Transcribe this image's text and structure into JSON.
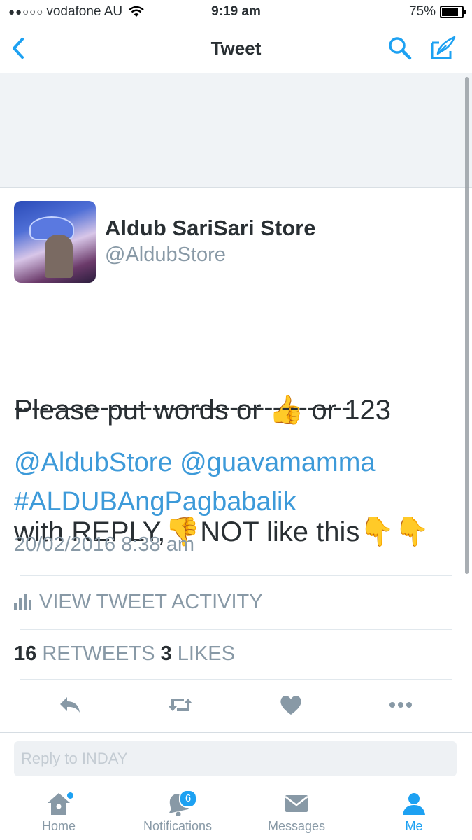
{
  "status_bar": {
    "signal_dots": "●●○○○",
    "carrier": "vodafone AU",
    "time": "9:19 am",
    "battery_label": "75%",
    "battery_level": 0.75
  },
  "nav": {
    "title": "Tweet",
    "back_icon": "chevron-left-icon",
    "search_icon": "search-icon",
    "compose_icon": "compose-icon"
  },
  "tweet": {
    "display_name": "Aldub SariSari Store",
    "handle": "@AldubStore",
    "text_line1": "Please put words or 👍 or 123",
    "text_line2": "with REPLY,👎NOT like this👇👇",
    "divider": "---------------------------------------",
    "mention1": "@AldubStore",
    "mention2": "@guavamamma",
    "hashtag": "#ALDUBAngPagbabalik",
    "timestamp": "20/02/2016 8:38 am"
  },
  "activity": {
    "label": "VIEW TWEET ACTIVITY"
  },
  "stats": {
    "retweets_count": "16",
    "retweets_label": "RETWEETS",
    "likes_count": "3",
    "likes_label": "LIKES"
  },
  "actions": [
    "reply-icon",
    "retweet-icon",
    "heart-icon",
    "more-icon"
  ],
  "reply": {
    "placeholder": "Reply to INDAY"
  },
  "tabbar": {
    "home": "Home",
    "notifications": "Notifications",
    "notifications_badge": "6",
    "messages": "Messages",
    "me": "Me"
  },
  "colors": {
    "accent": "#1da1f2",
    "link": "#3d9ad9",
    "muted": "#8899a6",
    "text": "#292f33"
  }
}
